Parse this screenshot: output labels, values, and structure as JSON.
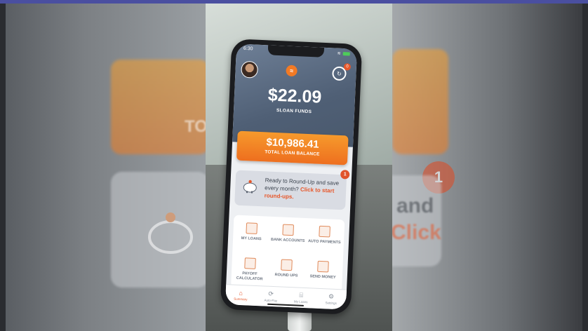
{
  "status": {
    "time": "6:30"
  },
  "header": {
    "funds_amount": "$22.09",
    "funds_label": "SLOAN FUNDS",
    "history_badge": "0"
  },
  "loan_card": {
    "amount": "$10,986.41",
    "label": "TOTAL LOAN BALANCE"
  },
  "roundup": {
    "badge": "1",
    "text": "Ready to Round-Up and save every month?",
    "link": "Click to start round-ups."
  },
  "tiles": [
    {
      "label": "MY LOANS",
      "icon": "loans-icon"
    },
    {
      "label": "BANK ACCOUNTS",
      "icon": "bank-icon"
    },
    {
      "label": "AUTO PAYMENTS",
      "icon": "auto-payment-icon"
    },
    {
      "label": "PAYOFF CALCULATOR",
      "icon": "calculator-icon"
    },
    {
      "label": "ROUND UPS",
      "icon": "piggy-bank-icon"
    },
    {
      "label": "SEND MONEY",
      "icon": "money-icon"
    }
  ],
  "tabs": [
    {
      "label": "Summary",
      "icon": "home-icon",
      "active": true
    },
    {
      "label": "Auto-Pay",
      "icon": "auto-pay-icon",
      "active": false
    },
    {
      "label": "My Loans",
      "icon": "bank-icon",
      "active": false
    },
    {
      "label": "Settings",
      "icon": "gear-icon",
      "active": false
    }
  ],
  "background_ghost": {
    "left_text": "TOT",
    "right_text_1": "and",
    "right_text_2": "Click",
    "right_badge": "1"
  },
  "colors": {
    "accent": "#e7572a",
    "orange": "#f07c22",
    "header": "#4f5f75"
  }
}
